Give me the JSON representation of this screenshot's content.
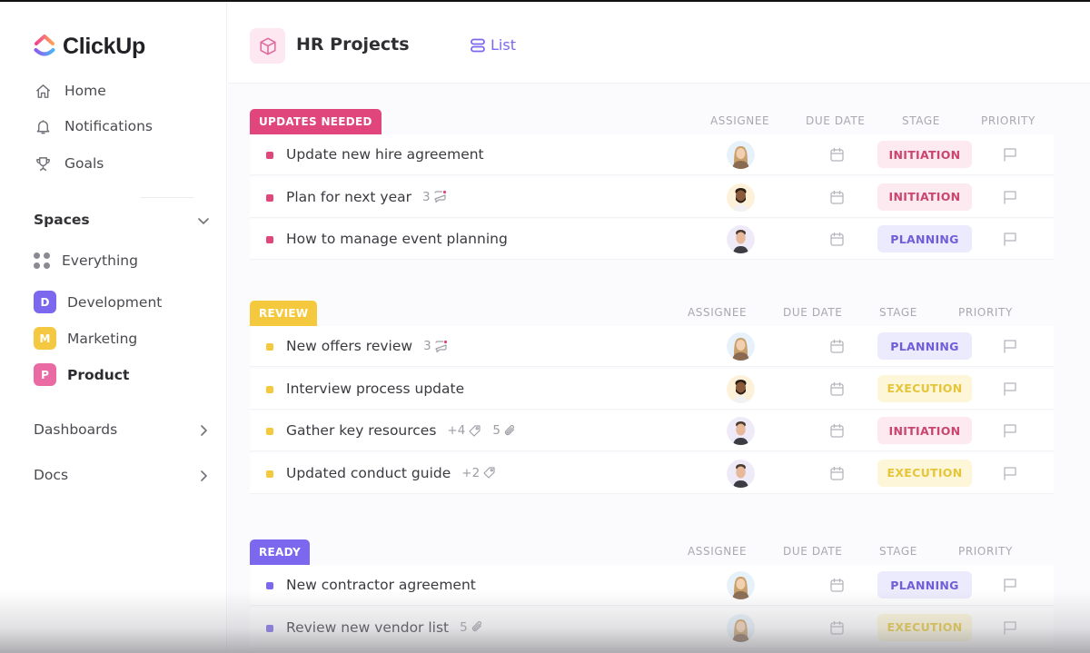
{
  "app": {
    "name": "ClickUp"
  },
  "sidebar": {
    "nav": [
      {
        "label": "Home",
        "icon": "home-icon"
      },
      {
        "label": "Notifications",
        "icon": "bell-icon"
      },
      {
        "label": "Goals",
        "icon": "trophy-icon"
      }
    ],
    "spaces_title": "Spaces",
    "everything_label": "Everything",
    "spaces": [
      {
        "initial": "D",
        "label": "Development",
        "color": "#7b68ee"
      },
      {
        "initial": "M",
        "label": "Marketing",
        "color": "#f5c842"
      },
      {
        "initial": "P",
        "label": "Product",
        "color": "#ea6ba3"
      }
    ],
    "dashboards_label": "Dashboards",
    "docs_label": "Docs"
  },
  "header": {
    "project_title": "HR Projects",
    "view_tab": "List"
  },
  "columns": {
    "assignee": "ASSIGNEE",
    "due_date": "DUE DATE",
    "stage": "STAGE",
    "priority": "PRIORITY"
  },
  "stage_colors": {
    "INITIATION": {
      "bg": "#fde9f0",
      "fg": "#c9466f"
    },
    "PLANNING": {
      "bg": "#ecebfd",
      "fg": "#6e5fd8"
    },
    "EXECUTION": {
      "bg": "#fdf6d8",
      "fg": "#e6c53a"
    }
  },
  "groups": [
    {
      "label": "UPDATES NEEDED",
      "color": "#e0457b",
      "tasks": [
        {
          "title": "Update new hire agreement",
          "assignee": "woman-blonde",
          "stage": "INITIATION"
        },
        {
          "title": "Plan for next year",
          "comments": "3",
          "assignee": "man-beard",
          "stage": "INITIATION"
        },
        {
          "title": "How to manage event planning",
          "assignee": "man-short-hair",
          "stage": "PLANNING"
        }
      ]
    },
    {
      "label": "REVIEW",
      "color": "#f5c93d",
      "tasks": [
        {
          "title": "New offers review",
          "comments": "3",
          "assignee": "woman-blonde",
          "stage": "PLANNING"
        },
        {
          "title": "Interview process update",
          "assignee": "man-beard",
          "stage": "EXECUTION"
        },
        {
          "title": "Gather key resources",
          "tags": "+4",
          "attachments": "5",
          "assignee": "man-short-hair",
          "stage": "INITIATION"
        },
        {
          "title": "Updated conduct guide",
          "tags": "+2",
          "assignee": "man-short-hair",
          "stage": "EXECUTION"
        }
      ]
    },
    {
      "label": "READY",
      "color": "#7b68ee",
      "tasks": [
        {
          "title": "New contractor agreement",
          "assignee": "woman-blonde",
          "stage": "PLANNING"
        },
        {
          "title": "Review new vendor list",
          "attachments": "5",
          "assignee": "woman-blonde",
          "stage": "EXECUTION"
        }
      ]
    }
  ]
}
